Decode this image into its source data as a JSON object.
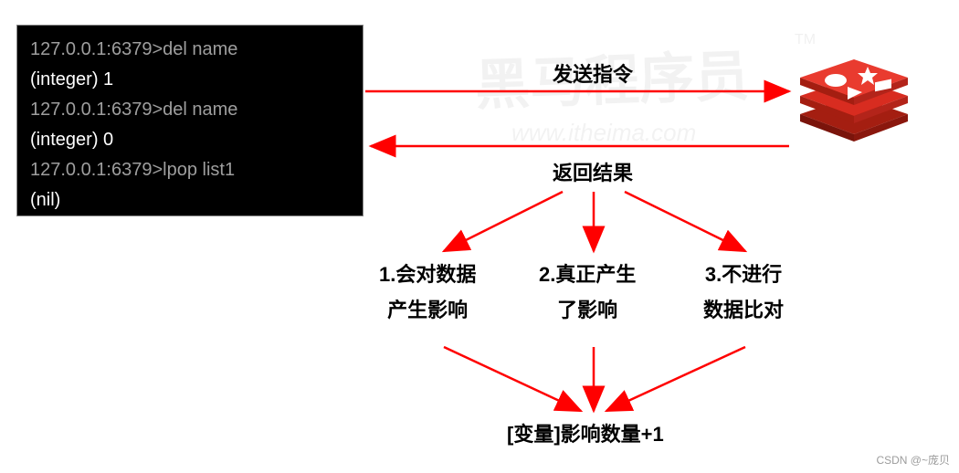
{
  "terminal": {
    "l1_prompt": "127.0.0.1:6379>",
    "l1_cmd": "del name",
    "l2": "(integer) 1",
    "l3_prompt": "127.0.0.1:6379>",
    "l3_cmd": "del name",
    "l4": "(integer) 0",
    "l5_prompt": "127.0.0.1:6379>",
    "l5_cmd": "lpop list1",
    "l6": "(nil)"
  },
  "labels": {
    "send": "发送指令",
    "return": "返回结果"
  },
  "branches": {
    "b1_l1": "1.会对数据",
    "b1_l2": "产生影响",
    "b2_l1": "2.真正产生",
    "b2_l2": "了影响",
    "b3_l1": "3.不进行",
    "b3_l2": "数据比对"
  },
  "result": "[变量]影响数量+1",
  "watermark": {
    "big": "黑马程序员",
    "url": "www.itheima.com",
    "tm": "TM"
  },
  "credit": "CSDN @~庞贝"
}
